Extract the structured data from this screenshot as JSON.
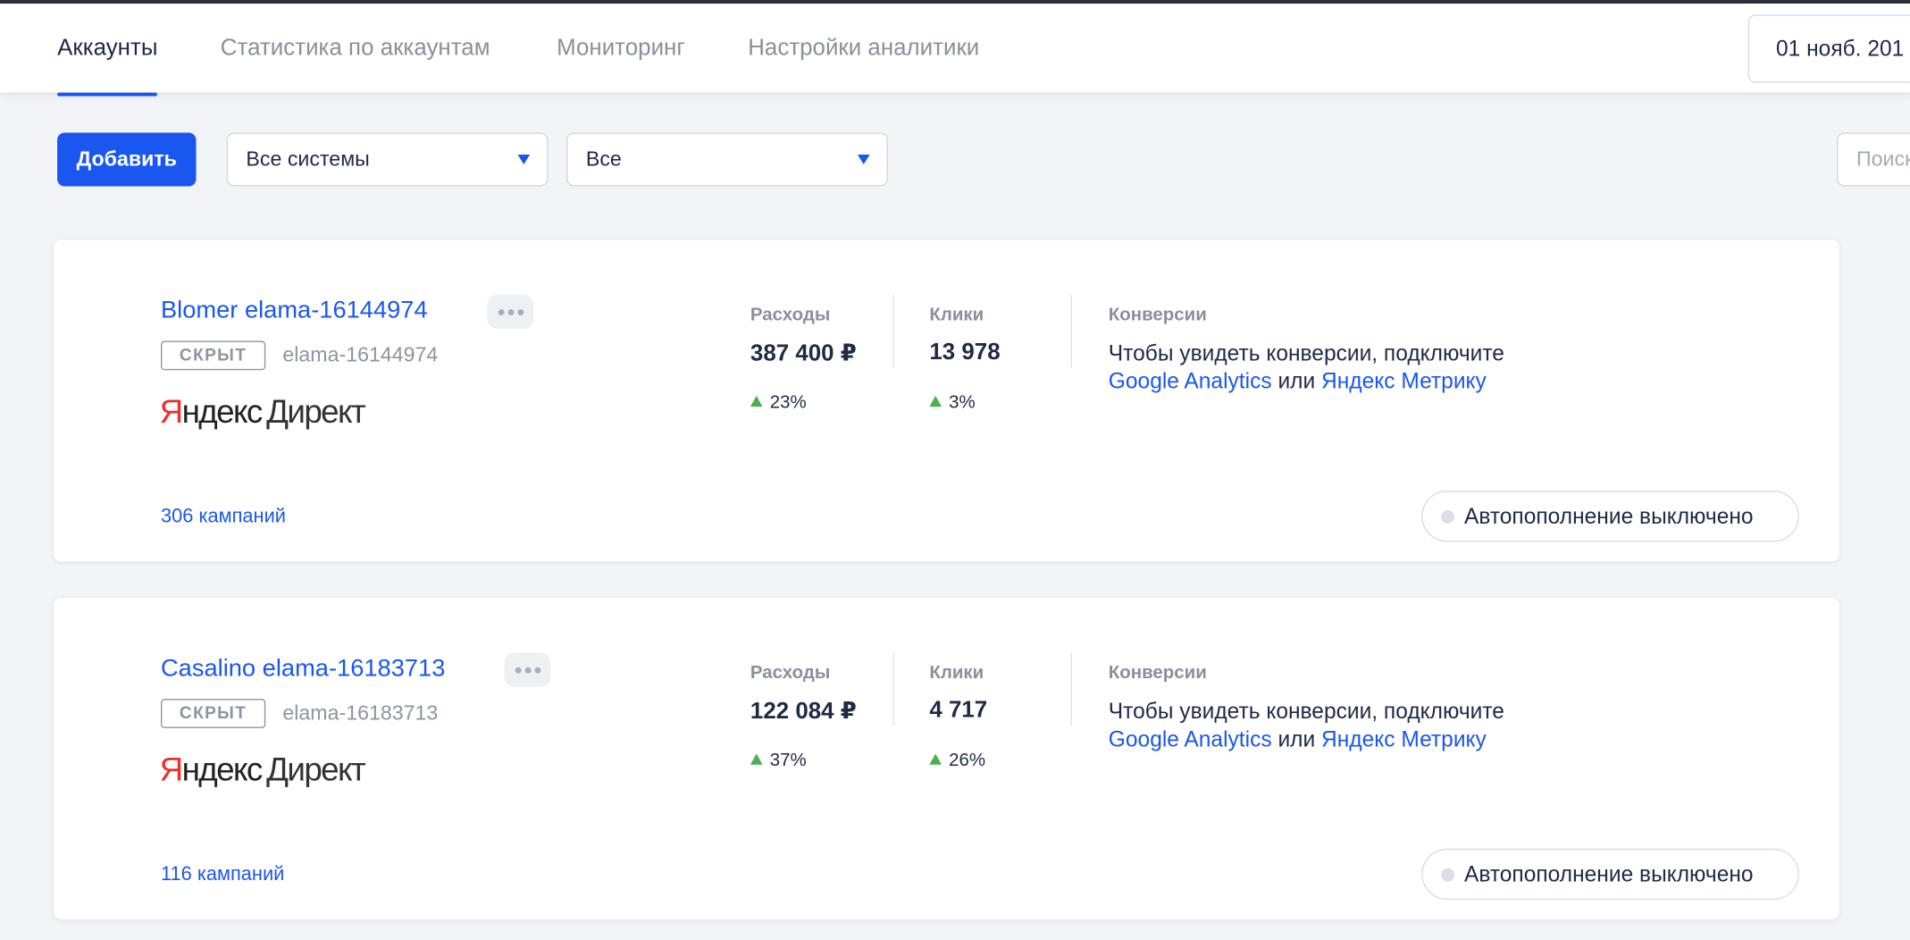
{
  "tabs": [
    {
      "label": "Аккаунты",
      "active": true
    },
    {
      "label": "Статистика по аккаунтам",
      "active": false
    },
    {
      "label": "Мониторинг",
      "active": false
    },
    {
      "label": "Настройки аналитики",
      "active": false
    }
  ],
  "date_range": "01 нояб. 201",
  "toolbar": {
    "add_label": "Добавить",
    "system_filter": "Все системы",
    "status_filter": "Все",
    "search_placeholder": "Поиск"
  },
  "colors": {
    "accent": "#1a57f0",
    "growth": "#4caf50",
    "page_bg": "#f3f4f7"
  },
  "metric_labels": {
    "spend": "Расходы",
    "clicks": "Клики",
    "conversions": "Конверсии"
  },
  "accounts": [
    {
      "name": "Blomer elama-16144974",
      "status": "СКРЫТ",
      "login": "elama-16144974",
      "system": {
        "ya_first": "Я",
        "ya_rest": "ндекс",
        "direct": "Директ"
      },
      "spend": "387 400 ₽",
      "spend_delta": "23%",
      "clicks": "13 978",
      "clicks_delta": "3%",
      "conv_text_1": "Чтобы увидеть конверсии, подключите ",
      "conv_link_ga": "Google Analytics",
      "conv_text_2": " или ",
      "conv_link_ym": "Яндекс Метрику",
      "campaigns": "306 кампаний",
      "autopay": "Автопополнение выключено"
    },
    {
      "name": "Casalino elama-16183713",
      "status": "СКРЫТ",
      "login": "elama-16183713",
      "system": {
        "ya_first": "Я",
        "ya_rest": "ндекс",
        "direct": "Директ"
      },
      "spend": "122 084 ₽",
      "spend_delta": "37%",
      "clicks": "4 717",
      "clicks_delta": "26%",
      "conv_text_1": "Чтобы увидеть конверсии, подключите ",
      "conv_link_ga": "Google Analytics",
      "conv_text_2": " или ",
      "conv_link_ym": "Яндекс Метрику",
      "campaigns": "116 кампаний",
      "autopay": "Автопополнение выключено"
    }
  ]
}
